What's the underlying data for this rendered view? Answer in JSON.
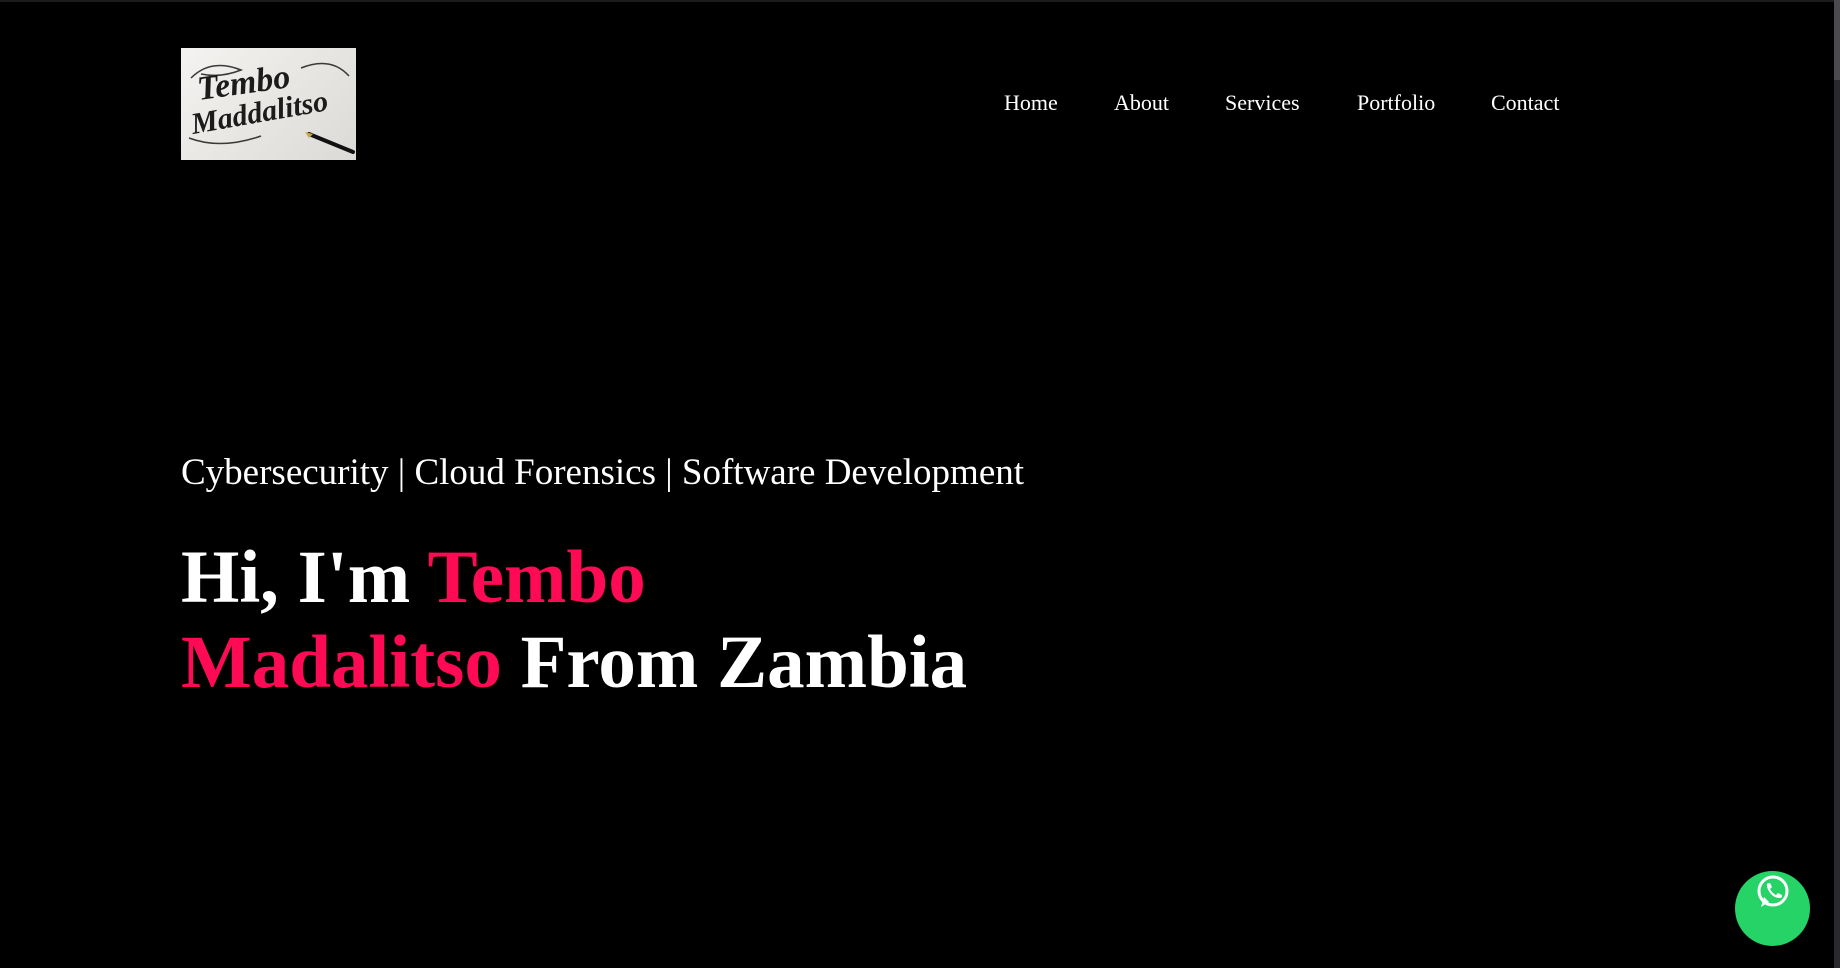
{
  "logo": {
    "line1": "Tembo",
    "line2": "Maddalitso",
    "icon": "fountain-pen-icon"
  },
  "nav": {
    "items": [
      {
        "label": "Home"
      },
      {
        "label": "About"
      },
      {
        "label": "Services"
      },
      {
        "label": "Portfolio"
      },
      {
        "label": "Contact"
      }
    ]
  },
  "hero": {
    "tagline": "Cybersecurity | Cloud Forensics | Software Development",
    "greeting": "Hi, I'm ",
    "first_name": "Tembo",
    "last_name": "Madalitso",
    "suffix": " From Zambia"
  },
  "whatsapp": {
    "icon": "whatsapp-icon"
  },
  "colors": {
    "background": "#000000",
    "text": "#ffffff",
    "accent": "#ff0a54",
    "whatsapp": "#25d366"
  }
}
